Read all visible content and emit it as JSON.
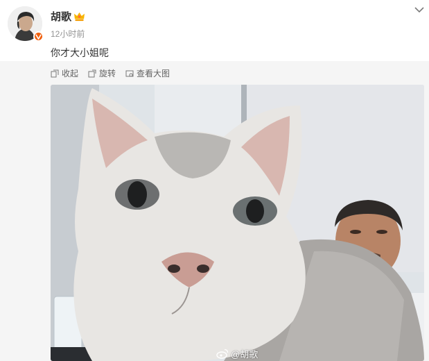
{
  "post": {
    "author": "胡歌",
    "time": "12小时前",
    "text": "你才大小姐呢"
  },
  "toolbar": {
    "collect": "收起",
    "rotate": "旋转",
    "view_large": "查看大图"
  },
  "image": {
    "watermark": "@胡歌"
  },
  "colors": {
    "verify_badge": "#f05f0d",
    "toolbar_bg": "#f5f5f5",
    "muted_text": "#939393"
  }
}
